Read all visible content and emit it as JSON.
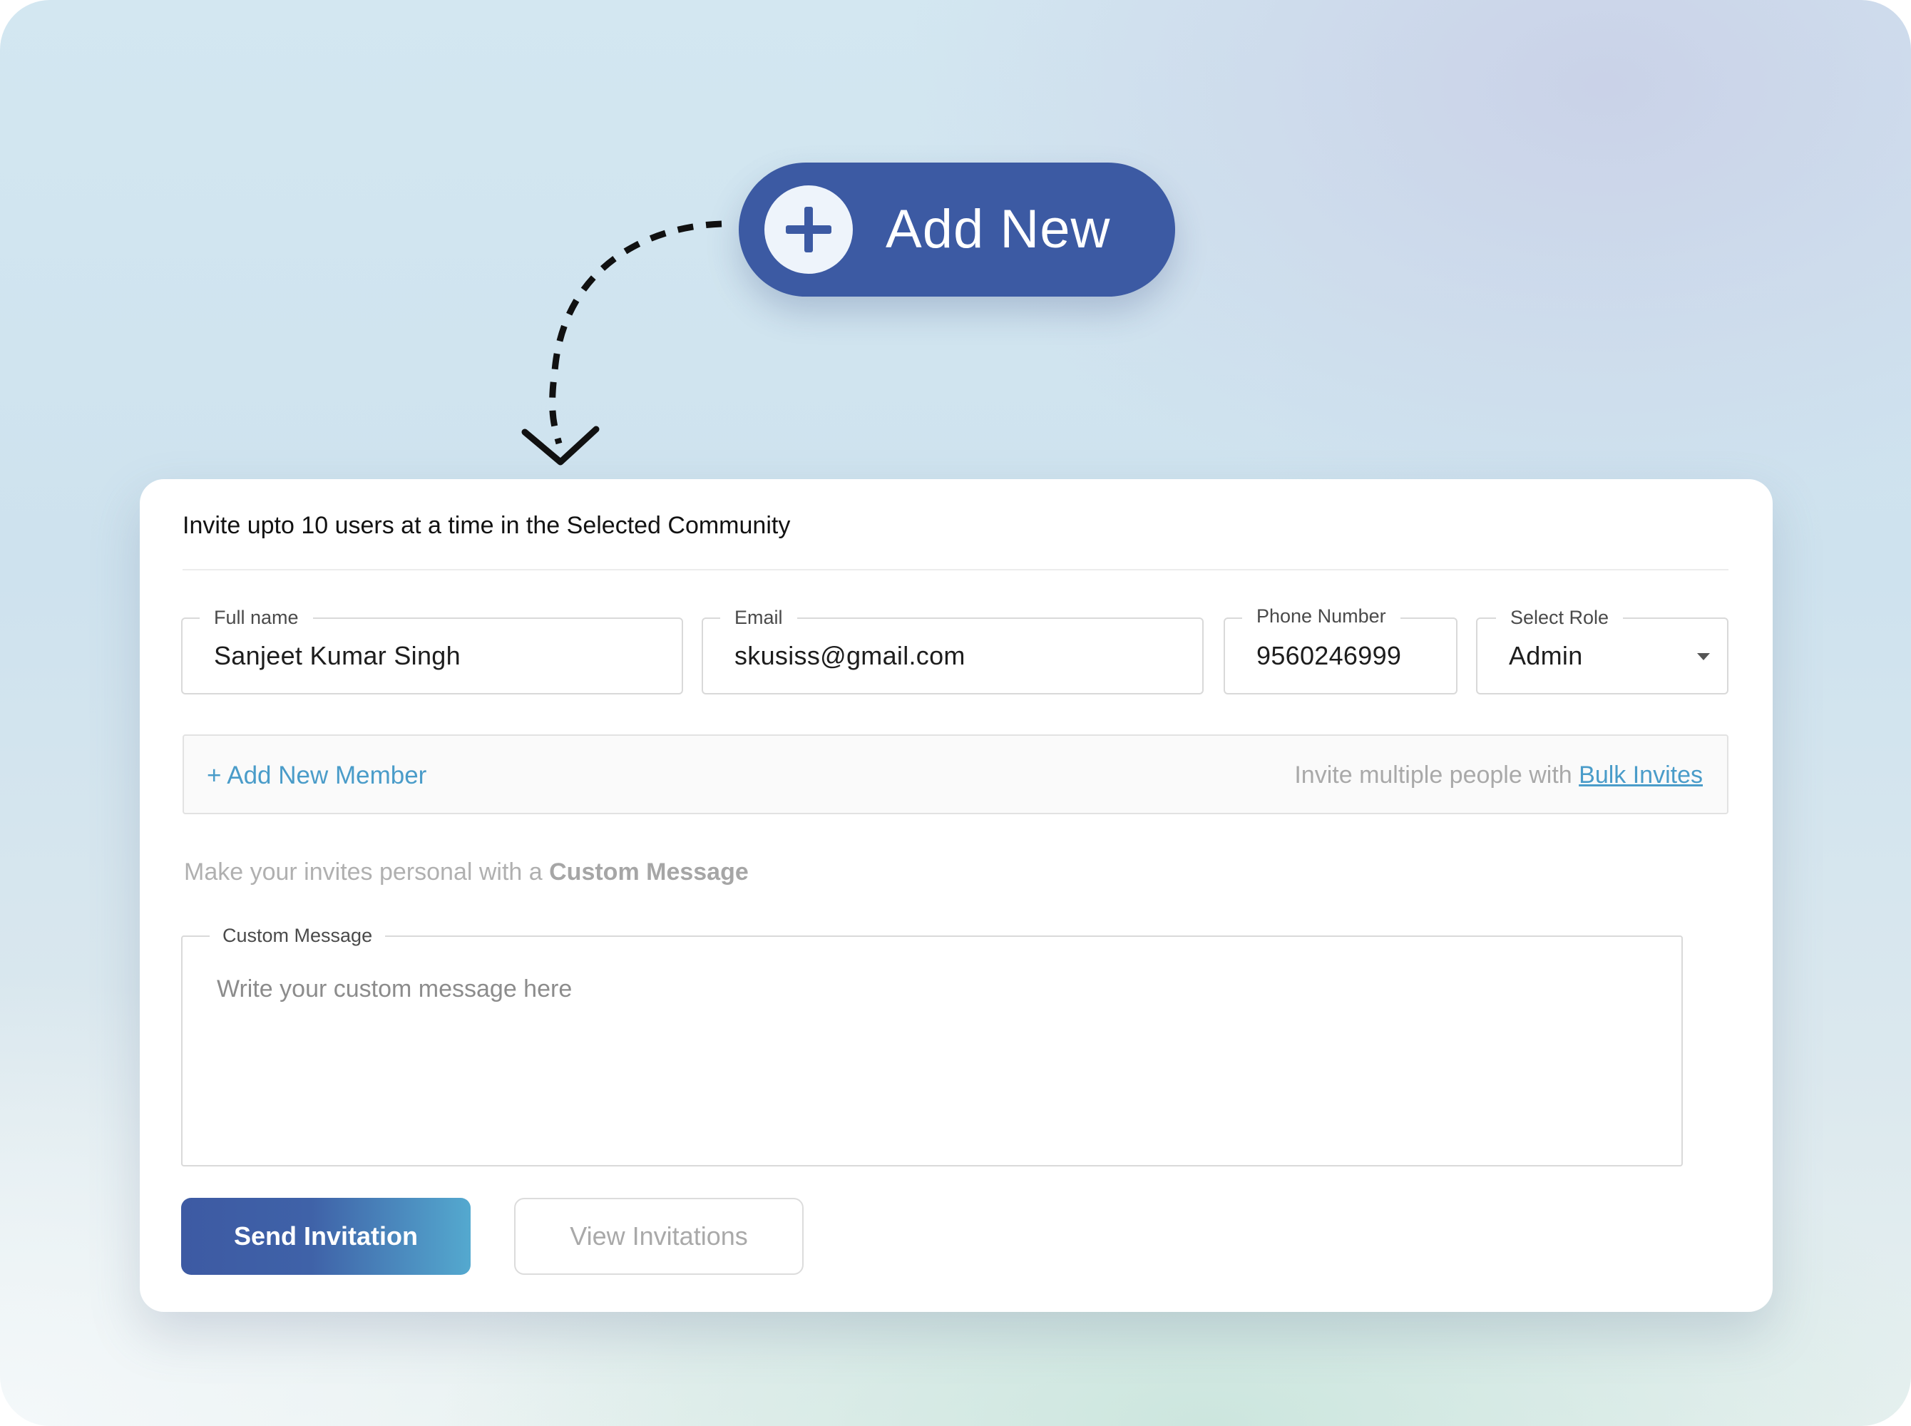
{
  "add_new_button": {
    "label": "Add New",
    "icon": "plus-icon",
    "color": "#3c5aa3"
  },
  "form": {
    "title": "Invite upto 10 users at a time in the Selected Community",
    "fields": {
      "full_name": {
        "label": "Full name",
        "value": "Sanjeet Kumar Singh"
      },
      "email": {
        "label": "Email",
        "value": "skusiss@gmail.com"
      },
      "phone": {
        "label": "Phone Number",
        "value": "9560246999"
      },
      "role": {
        "label": "Select Role",
        "value": "Admin",
        "icon": "dropdown-caret-icon"
      }
    },
    "add_member_label": "+ Add New Member",
    "bulk_prefix": "Invite multiple people with ",
    "bulk_link": "Bulk Invites",
    "personal_prefix": "Make your invites personal with a ",
    "personal_emphasis": "Custom Message",
    "message": {
      "label": "Custom Message",
      "placeholder": "Write your custom message here"
    },
    "send_button": "Send Invitation",
    "view_button": "View Invitations",
    "accent_color": "#4a9cc9"
  }
}
